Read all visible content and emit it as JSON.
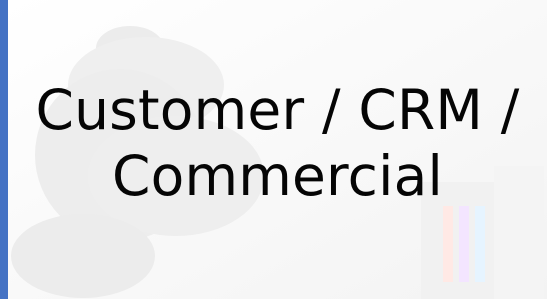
{
  "slide": {
    "title": "Customer / CRM /\nCommercial",
    "colors": {
      "accent_bar": "#4472c4",
      "background": "#f7f7f7",
      "text": "#050505"
    }
  }
}
